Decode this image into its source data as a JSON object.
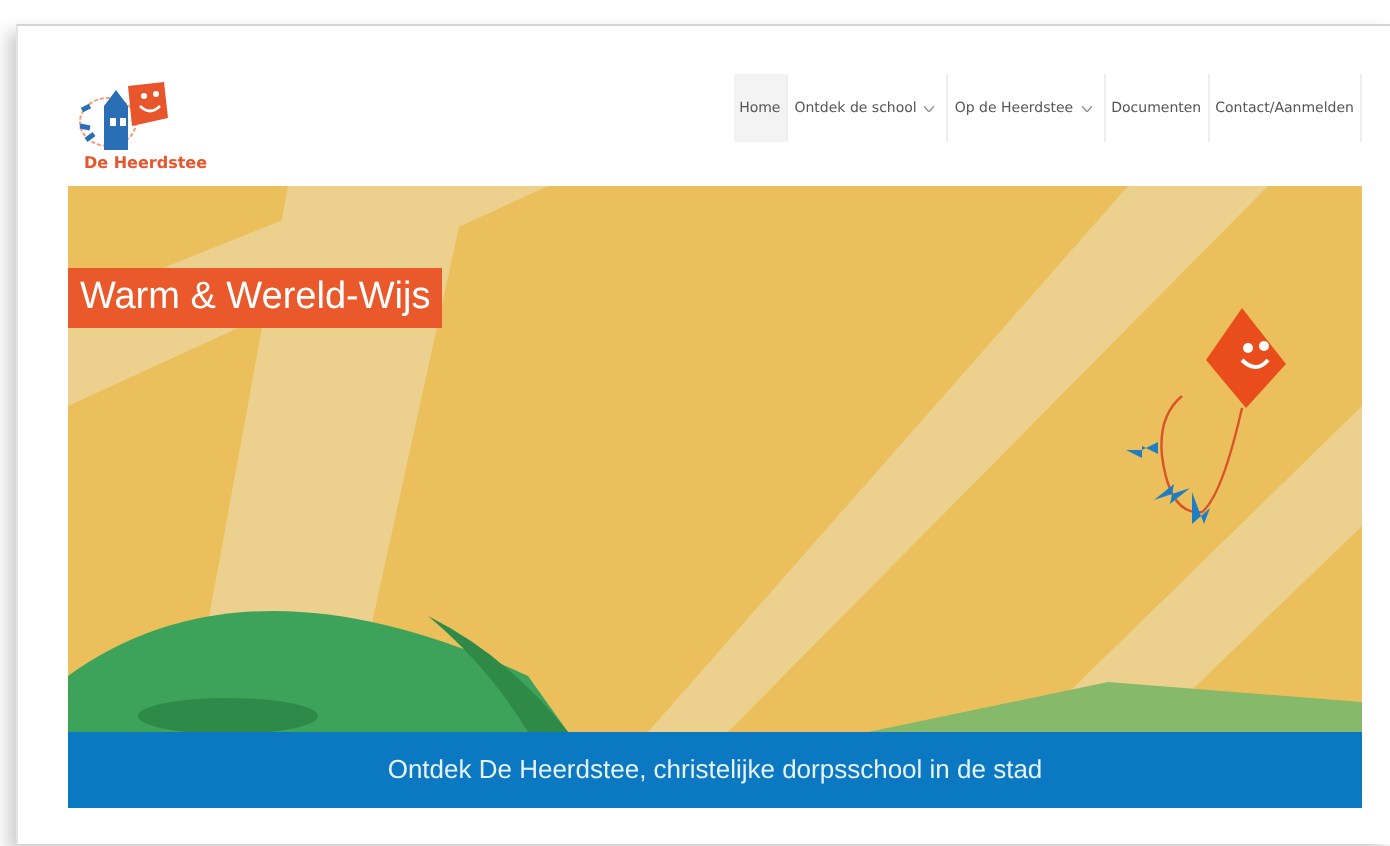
{
  "logo": {
    "name": "De Heerdstee"
  },
  "nav": [
    {
      "label": "Home",
      "selected": true,
      "dropdown": false
    },
    {
      "label": "Ontdek de school",
      "selected": false,
      "dropdown": true
    },
    {
      "label": "Op de Heerdstee",
      "selected": false,
      "dropdown": true
    },
    {
      "label": "Documenten",
      "selected": false,
      "dropdown": false
    },
    {
      "label": "Contact/Aanmelden",
      "selected": false,
      "dropdown": false
    }
  ],
  "banner": {
    "tagline": "Warm & Wereld-Wijs",
    "caption": "Ontdek De Heerdstee, christelijke dorpsschool in de stad"
  }
}
